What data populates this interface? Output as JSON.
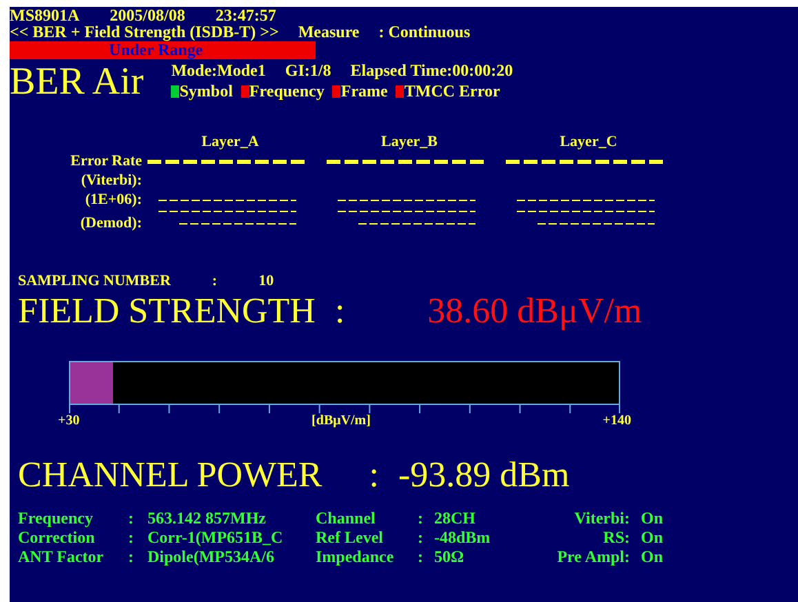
{
  "header": {
    "model": "MS8901A",
    "date": "2005/08/08",
    "time": "23:47:57",
    "mode_title": "<< BER + Field Strength (ISDB-T) >>",
    "measure_label": "Measure",
    "measure_value": ": Continuous"
  },
  "alarm": {
    "text": "Under Range"
  },
  "title": "BER Air",
  "status": {
    "mode": "Mode:Mode1",
    "gi": "GI:1/8",
    "elapsed": "Elapsed Time:00:00:20"
  },
  "indicators": [
    {
      "label": "Symbol",
      "color": "#00cc33"
    },
    {
      "label": "Frequency",
      "color": "#ee0000"
    },
    {
      "label": "Frame",
      "color": "#ee0000"
    },
    {
      "label": "TMCC Error",
      "color": "#ee0000"
    }
  ],
  "error_table": {
    "columns": [
      "Layer_A",
      "Layer_B",
      "Layer_C"
    ],
    "rows": [
      {
        "label": "Error Rate",
        "kind": "heavy"
      },
      {
        "label": "(Viterbi):",
        "kind": "blank"
      },
      {
        "label": "(1E+06):",
        "kind": "dash"
      },
      {
        "label": "",
        "kind": "dash"
      },
      {
        "label": "(Demod):",
        "kind": "short"
      }
    ]
  },
  "sampling": {
    "label": "SAMPLING NUMBER",
    "sep": ":",
    "value": "10"
  },
  "field_strength": {
    "label": "FIELD STRENGTH",
    "sep": ":",
    "value": "38.60 dBμV/m"
  },
  "meter": {
    "level": 0.078,
    "min": "+30",
    "unit": "[dBμV/m]",
    "max": "+140"
  },
  "channel_power": {
    "label": "CHANNEL POWER",
    "sep": ":",
    "value": "-93.89 dBm"
  },
  "info_rows": [
    [
      {
        "label": "Frequency",
        "sep": ":",
        "value": "563.142 857MHz"
      },
      {
        "label": "Channel",
        "sep": ":",
        "value": "28CH"
      },
      {
        "label": "Viterbi",
        "sep": ":",
        "value": "On"
      }
    ],
    [
      {
        "label": "Correction",
        "sep": ":",
        "value": "Corr-1(MP651B_C"
      },
      {
        "label": "Ref Level",
        "sep": ":",
        "value": "-48dBm"
      },
      {
        "label": "RS",
        "sep": ":",
        "value": "On"
      }
    ],
    [
      {
        "label": "ANT Factor",
        "sep": ":",
        "value": "Dipole(MP534A/6"
      },
      {
        "label": "Impedance",
        "sep": ":",
        "value": "50Ω"
      },
      {
        "label": "Pre Ampl",
        "sep": ":",
        "value": "On"
      }
    ]
  ]
}
